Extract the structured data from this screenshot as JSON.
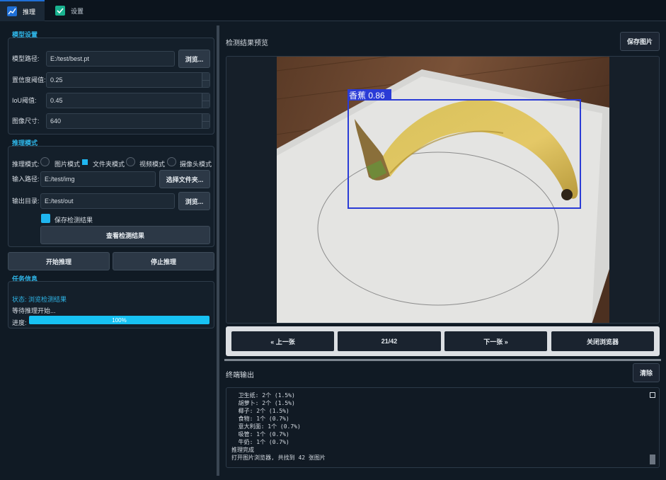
{
  "tabs": [
    {
      "label": "推理",
      "icon": "chart-icon",
      "active": true
    },
    {
      "label": "设置",
      "icon": "checkmark-icon",
      "active": false
    }
  ],
  "model_settings": {
    "title": "模型设置",
    "model_path": {
      "label": "模型路径:",
      "value": "E:/test/best.pt",
      "browse": "浏览..."
    },
    "confidence": {
      "label": "置信度阈值:",
      "value": "0.25"
    },
    "iou": {
      "label": "IoU阈值:",
      "value": "0.45"
    },
    "image_size": {
      "label": "图像尺寸:",
      "value": "640"
    }
  },
  "inference_mode": {
    "title": "推理模式",
    "mode_label": "推理模式:",
    "modes": [
      "图片模式",
      "文件夹模式",
      "视频模式",
      "摄像头模式"
    ],
    "selected_mode": "文件夹模式",
    "input_label": "输入路径:",
    "input_value": "E:/test/img",
    "select_folder": "选择文件夹...",
    "output_label": "输出目录:",
    "output_value": "E:/test/out",
    "output_browse": "浏览...",
    "save_results_label": "保存检测结果",
    "save_results_checked": true,
    "view_results": "查看检测结果"
  },
  "actions": {
    "start": "开始推理",
    "stop": "停止推理"
  },
  "task_info": {
    "title": "任务信息",
    "status": "状态: 浏览检测结果",
    "waiting": "等待推理开始...",
    "progress_label": "进度:",
    "progress_value": 100,
    "progress_text": "100%"
  },
  "preview": {
    "title": "检测结果预览",
    "save_image": "保存图片",
    "detection": {
      "label": "香蕉",
      "score": "0.86",
      "box_color": "#2a3bd6"
    }
  },
  "navigation": {
    "prev": "« 上一张",
    "counter": "21/42",
    "next": "下一张 »",
    "close": "关闭浏览器"
  },
  "terminal": {
    "title": "终端输出",
    "clear": "清除",
    "lines": [
      "  卫生纸: 2个 (1.5%)",
      "  胡萝卜: 2个 (1.5%)",
      "  椰子: 2个 (1.5%)",
      "  食物: 1个 (0.7%)",
      "  意大利面: 1个 (0.7%)",
      "  吸管: 1个 (0.7%)",
      "  牛奶: 1个 (0.7%)",
      "推理完成",
      "打开图片浏览器, 共找到 42 张图片"
    ]
  },
  "colors": {
    "accent": "#2fb6e8",
    "progress": "#17c2f3",
    "background": "#101a24"
  }
}
